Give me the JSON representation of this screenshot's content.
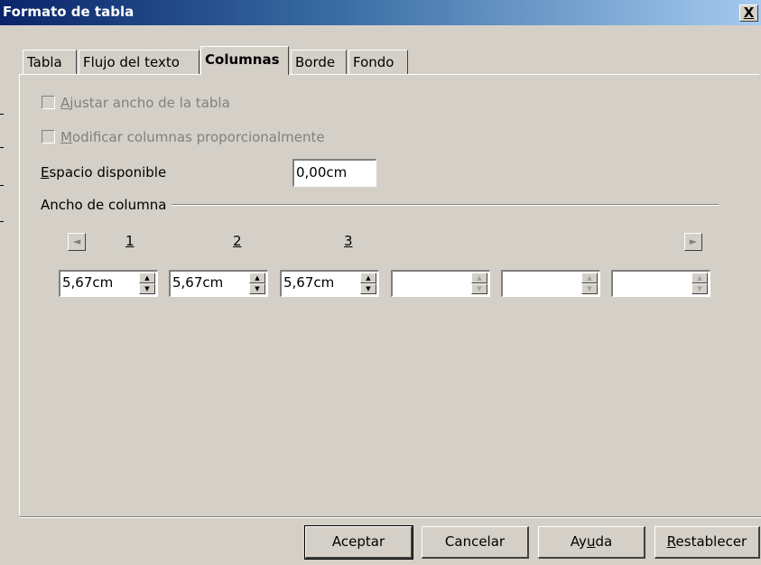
{
  "window": {
    "title": "Formato de tabla",
    "close_label": "X"
  },
  "tabs": [
    {
      "label": "Tabla",
      "active": false
    },
    {
      "label": "Flujo del texto",
      "active": false
    },
    {
      "label": "Columnas",
      "active": true
    },
    {
      "label": "Borde",
      "active": false
    },
    {
      "label": "Fondo",
      "active": false
    }
  ],
  "options": {
    "adjust_width": {
      "mnemonic": "A",
      "rest": "justar ancho de la tabla",
      "checked": false,
      "enabled": false
    },
    "modify_proportional": {
      "mnemonic": "M",
      "rest": "odificar columnas proporcionalmente",
      "checked": false,
      "enabled": false
    }
  },
  "available_space": {
    "mnemonic": "E",
    "rest": "spacio disponible",
    "value": "0,00cm"
  },
  "column_width": {
    "heading": "Ancho de columna",
    "left_arrow": "◄",
    "right_arrow": "►",
    "column_numbers": [
      "1",
      "2",
      "3"
    ],
    "widths": [
      "5,67cm",
      "5,67cm",
      "5,67cm",
      "",
      "",
      ""
    ]
  },
  "buttons": {
    "ok": "Aceptar",
    "cancel": "Cancelar",
    "help_pre": "Ay",
    "help_mn": "u",
    "help_post": "da",
    "reset_mn": "R",
    "reset_rest": "establecer"
  },
  "colors": {
    "title_start": "#0a246a",
    "title_end": "#a6caf0",
    "face": "#d4d0c8"
  }
}
